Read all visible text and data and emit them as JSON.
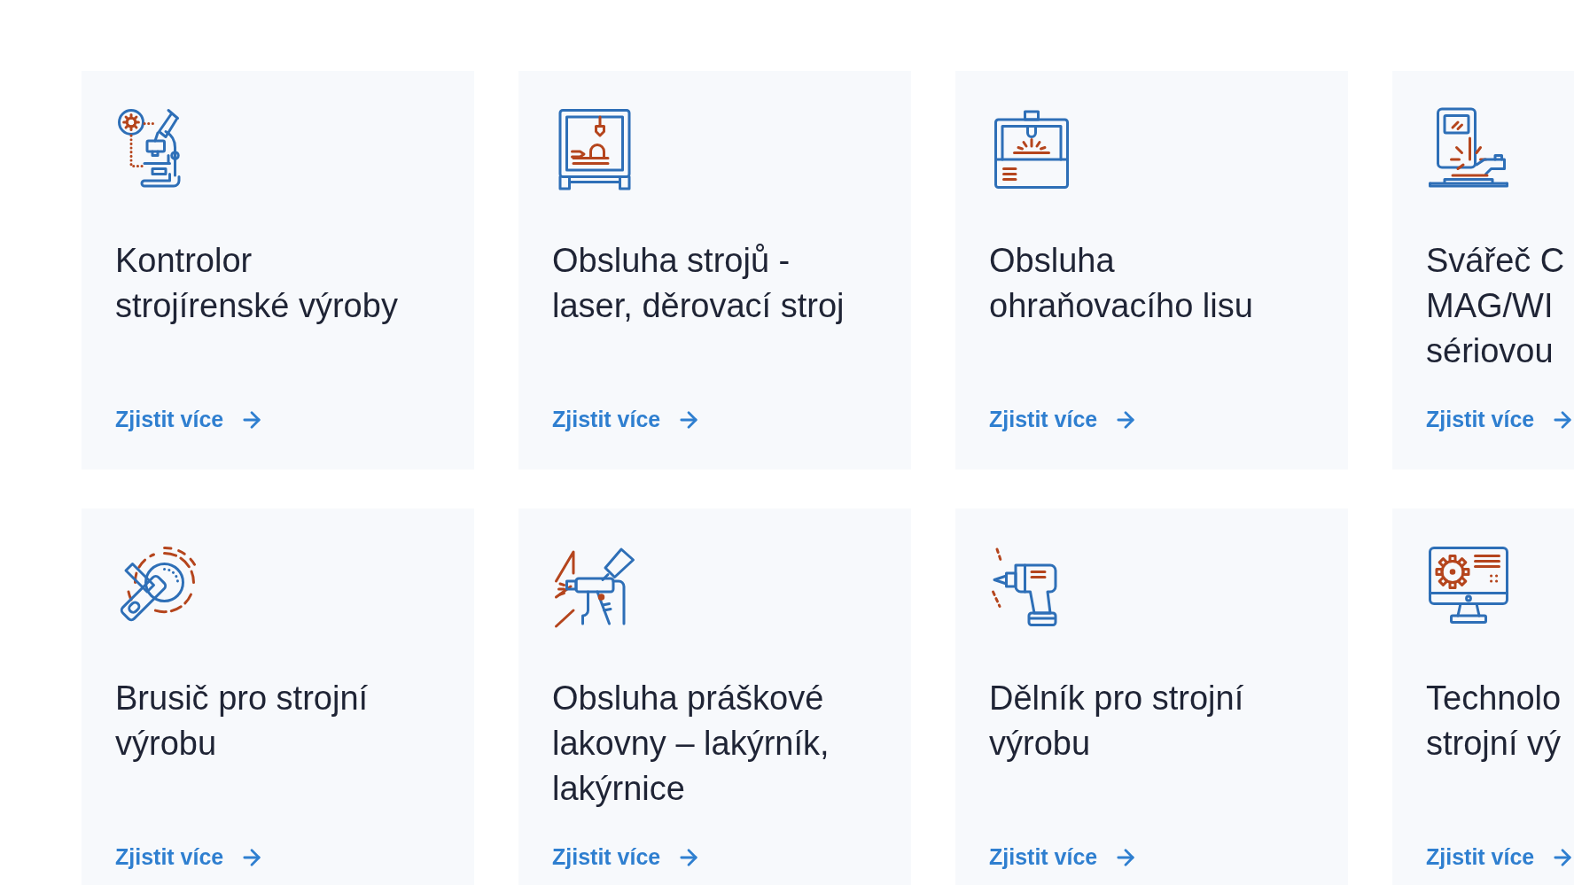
{
  "cards": [
    {
      "title_lines": [
        "Kontrolor",
        "strojírenské výroby"
      ],
      "link": "Zjistit více"
    },
    {
      "title_lines": [
        "Obsluha strojů -",
        "laser, děrovací stroj"
      ],
      "link": "Zjistit více"
    },
    {
      "title_lines": [
        "Obsluha",
        "ohraňovacího lisu"
      ],
      "link": "Zjistit více"
    },
    {
      "title_lines": [
        "Svářeč C",
        "MAG/WI",
        "sériovou"
      ],
      "link": "Zjistit více"
    },
    {
      "title_lines": [
        "Brusič pro strojní",
        "výrobu"
      ],
      "link": "Zjistit více"
    },
    {
      "title_lines": [
        "Obsluha práškové",
        "lakovny – lakýrník,",
        "lakýrnice"
      ],
      "link": "Zjistit více"
    },
    {
      "title_lines": [
        "Dělník pro strojní",
        "výrobu"
      ],
      "link": "Zjistit více"
    },
    {
      "title_lines": [
        "Technolo",
        "strojní vý"
      ],
      "link": "Zjistit více"
    }
  ]
}
